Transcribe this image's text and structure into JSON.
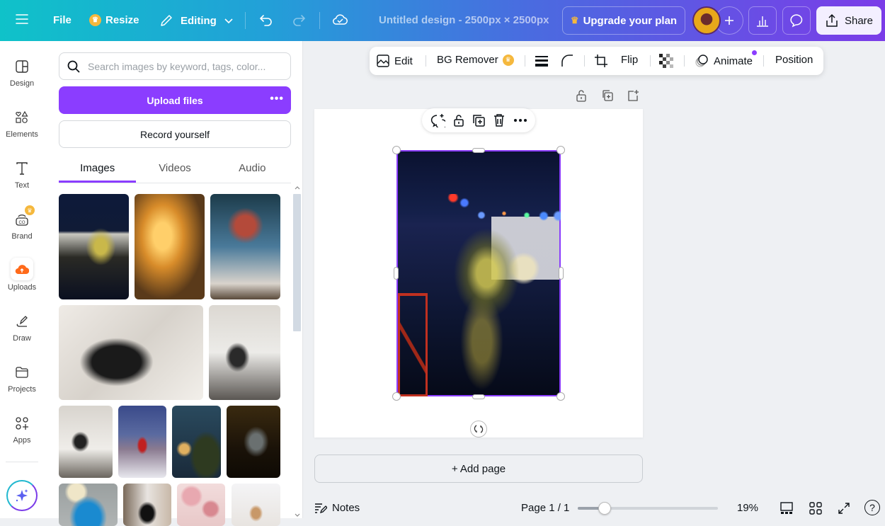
{
  "topbar": {
    "menu_icon": "hamburger-icon",
    "file_label": "File",
    "resize_label": "Resize",
    "editing_label": "Editing",
    "title": "Untitled design - 2500px × 2500px",
    "upgrade_label": "Upgrade your plan",
    "share_label": "Share",
    "accent": "#8b3dff"
  },
  "rail": {
    "items": [
      {
        "label": "Design",
        "icon": "design-icon"
      },
      {
        "label": "Elements",
        "icon": "elements-icon"
      },
      {
        "label": "Text",
        "icon": "text-icon"
      },
      {
        "label": "Brand",
        "icon": "brand-icon"
      },
      {
        "label": "Uploads",
        "icon": "uploads-icon"
      },
      {
        "label": "Draw",
        "icon": "draw-icon"
      },
      {
        "label": "Projects",
        "icon": "projects-icon"
      },
      {
        "label": "Apps",
        "icon": "apps-icon"
      }
    ]
  },
  "panel": {
    "search_placeholder": "Search images by keyword, tags, color...",
    "upload_label": "Upload files",
    "record_label": "Record yourself",
    "tabs": [
      {
        "label": "Images",
        "active": true
      },
      {
        "label": "Videos",
        "active": false
      },
      {
        "label": "Audio",
        "active": false
      }
    ],
    "thumbnails": [
      {
        "desc": "Night courtyard with Christmas tree and string lights"
      },
      {
        "desc": "Woman with phone by lit building"
      },
      {
        "desc": "Glass conservatory with wreaths"
      },
      {
        "desc": "Woman reading in chair"
      },
      {
        "desc": "Woman at table by window"
      },
      {
        "desc": "Woman at table in bright room"
      },
      {
        "desc": "Person in red coat on bridge"
      },
      {
        "desc": "Woman by river at dusk"
      },
      {
        "desc": "Dark restaurant interior"
      },
      {
        "desc": "Person in beanie and blue jacket"
      },
      {
        "desc": "Woman on city street"
      },
      {
        "desc": "Pink cosmetics flatlay"
      },
      {
        "desc": "White interior hallway"
      }
    ]
  },
  "context_toolbar": {
    "edit_label": "Edit",
    "bg_remover_label": "BG Remover",
    "flip_label": "Flip",
    "animate_label": "Animate",
    "position_label": "Position"
  },
  "canvas": {
    "add_page_label": "+ Add page"
  },
  "footer": {
    "notes_label": "Notes",
    "page_label": "Page 1 / 1",
    "zoom_label": "19%",
    "zoom_value": 0.19
  }
}
